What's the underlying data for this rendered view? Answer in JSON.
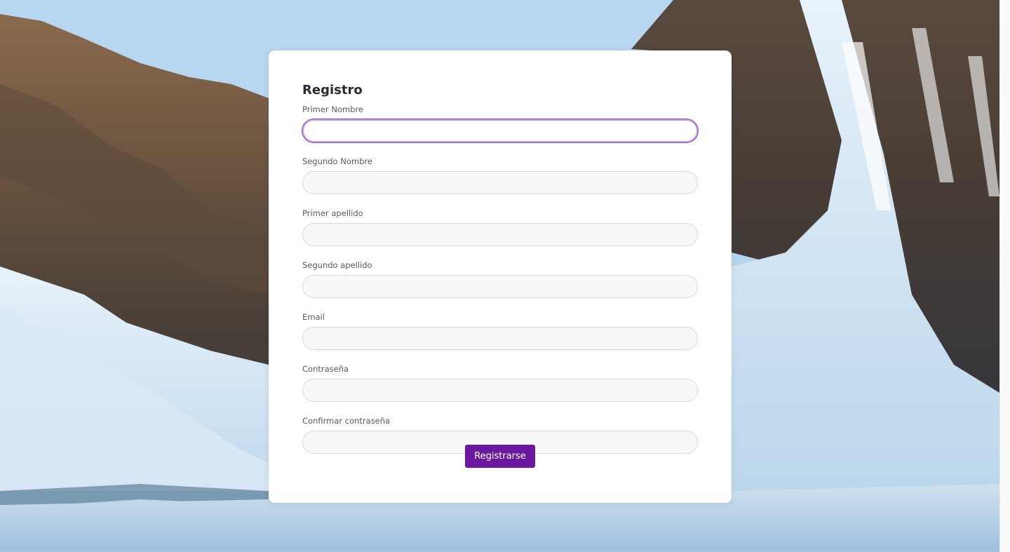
{
  "form": {
    "title": "Registro",
    "fields": [
      {
        "label": "Primer Nombre",
        "value": "",
        "placeholder": ""
      },
      {
        "label": "Segundo Nombre",
        "value": "",
        "placeholder": ""
      },
      {
        "label": "Primer apellido",
        "value": "",
        "placeholder": ""
      },
      {
        "label": "Segundo apellido",
        "value": "",
        "placeholder": ""
      },
      {
        "label": "Email",
        "value": "",
        "placeholder": ""
      },
      {
        "label": "Contraseña",
        "value": "",
        "placeholder": ""
      },
      {
        "label": "Confirmar contraseña",
        "value": "",
        "placeholder": ""
      }
    ],
    "submit_label": "Registrarse"
  },
  "colors": {
    "accent": "#6a199e",
    "focus_ring": "#c79de6",
    "input_bg": "#f7f8fa",
    "card_bg": "#ffffff"
  }
}
